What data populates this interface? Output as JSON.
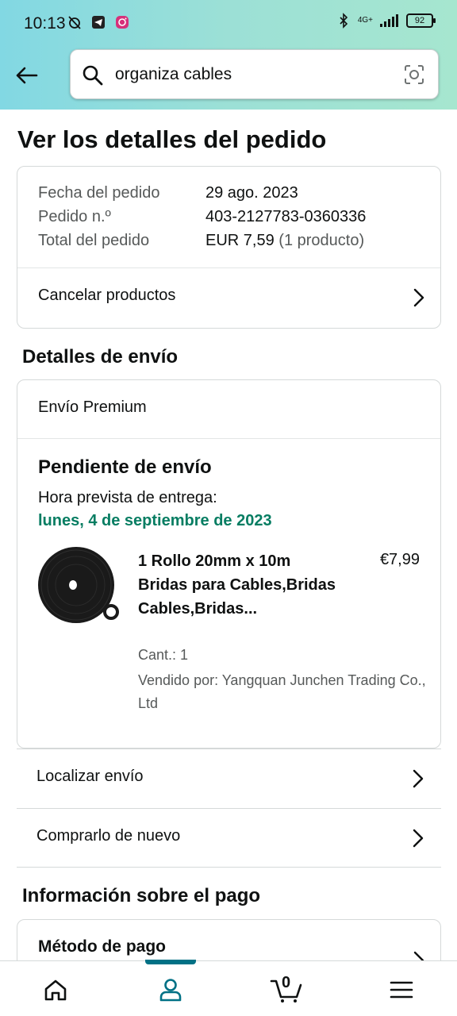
{
  "status": {
    "time": "10:13",
    "network": "4G+",
    "battery": "92"
  },
  "search": {
    "value": "organiza cables"
  },
  "page": {
    "title": "Ver los detalles del pedido"
  },
  "order": {
    "date_label": "Fecha del pedido",
    "date_value": "29 ago. 2023",
    "number_label": "Pedido n.º",
    "number_value": "403-2127783-0360336",
    "total_label": "Total del pedido",
    "total_value": "EUR 7,59",
    "total_count": "(1 producto)",
    "cancel_label": "Cancelar productos"
  },
  "shipping": {
    "section_title": "Detalles de envío",
    "method": "Envío Premium",
    "status_title": "Pendiente de envío",
    "eta_label": "Hora prevista de entrega:",
    "eta_date": "lunes, 4 de septiembre de 2023",
    "product": {
      "name": "1 Rollo 20mm x 10m Bridas para Cables,Bridas Cables,Bridas...",
      "price": "€7,99",
      "quantity": "Cant.: 1",
      "seller": "Vendido por: Yangquan Junchen Trading Co., Ltd"
    },
    "track_label": "Localizar envío",
    "buy_again_label": "Comprarlo de nuevo"
  },
  "payment": {
    "section_title": "Información sobre el pago",
    "method_label": "Método de pago"
  },
  "bottom_nav": {
    "cart_count": "0",
    "items": [
      "home-icon",
      "account-icon",
      "cart-icon",
      "menu-icon"
    ]
  },
  "colors": {
    "header_gradient_start": "#82d8e3",
    "header_gradient_end": "#a6e6cf",
    "delivery_green": "#067d62",
    "active_tab": "#007185"
  }
}
